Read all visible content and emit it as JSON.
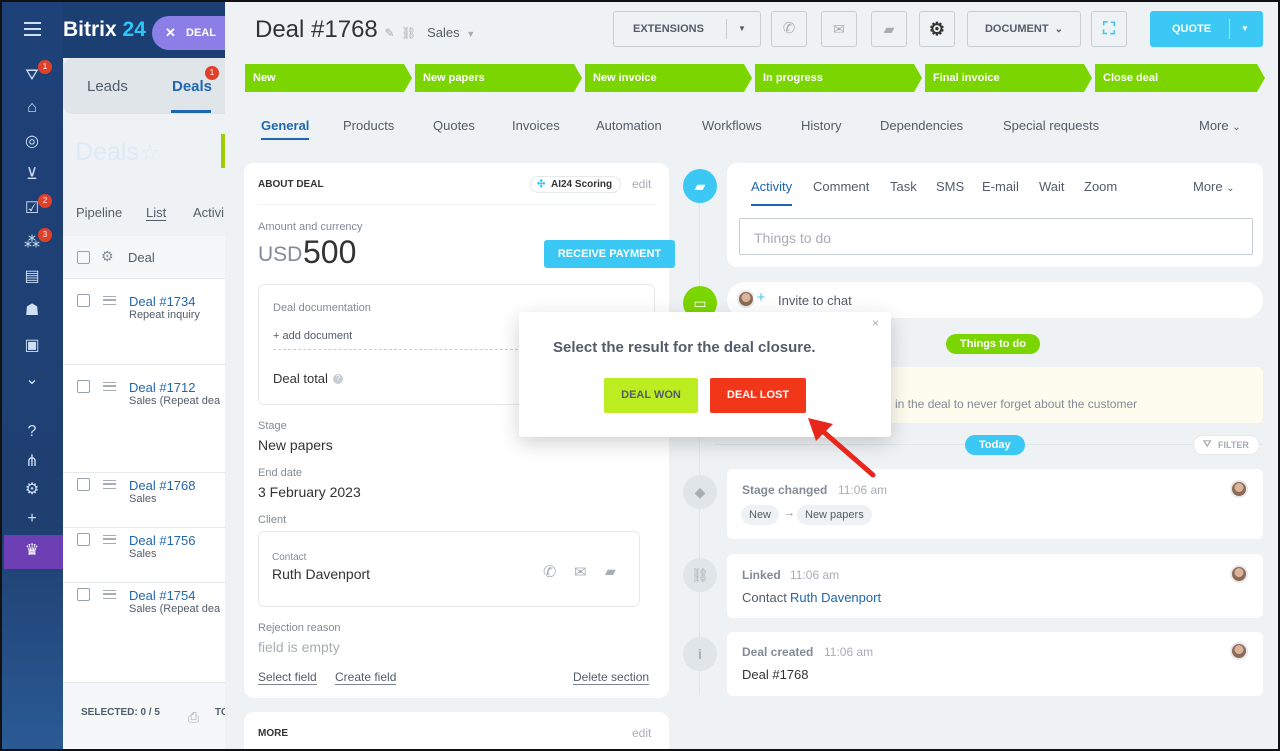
{
  "app": {
    "brand_name": "Bitrix",
    "brand_num": "24"
  },
  "left_toolbar": {
    "badges": [
      "1",
      "2",
      "3"
    ]
  },
  "background_crm": {
    "tab_leads": "Leads",
    "tab_deals": "Deals",
    "tab_deals_badge": "1",
    "deals_chip": "DEAL",
    "page_title": "Deals",
    "view_pipeline": "Pipeline",
    "view_list": "List",
    "view_activities": "Activi",
    "col_deal": "Deal",
    "rows": [
      {
        "title": "Deal #1734",
        "sub": "Repeat inquiry"
      },
      {
        "title": "Deal #1712",
        "sub": "Sales (Repeat dea"
      },
      {
        "title": "Deal #1768",
        "sub": "Sales"
      },
      {
        "title": "Deal #1756",
        "sub": "Sales"
      },
      {
        "title": "Deal #1754",
        "sub": "Sales (Repeat dea"
      }
    ],
    "selected": "SELECTED: 0 / 5",
    "to": "TO"
  },
  "header": {
    "title": "Deal #1768",
    "pipeline": "Sales",
    "extensions": "EXTENSIONS",
    "document": "DOCUMENT",
    "quote": "QUOTE"
  },
  "stages": [
    "New",
    "New papers",
    "New invoice",
    "In progress",
    "Final invoice",
    "Close deal"
  ],
  "stage_color": "#7bd500",
  "tabs": [
    "General",
    "Products",
    "Quotes",
    "Invoices",
    "Automation",
    "Workflows",
    "History",
    "Dependencies",
    "Special requests",
    "More"
  ],
  "about": {
    "heading": "ABOUT DEAL",
    "ai_scoring": "AI24 Scoring",
    "edit": "edit",
    "amount_label": "Amount and currency",
    "currency": "USD",
    "amount": "500",
    "receive_payment": "RECEIVE PAYMENT",
    "doc_label": "Deal documentation",
    "add_document": "+ add document",
    "deal_total": "Deal total",
    "stage_label": "Stage",
    "stage_value": "New papers",
    "end_date_label": "End date",
    "end_date_value": "3 February 2023",
    "client_label": "Client",
    "contact_label": "Contact",
    "contact_name": "Ruth Davenport",
    "rejection_label": "Rejection reason",
    "rejection_value": "field is empty",
    "select_field": "Select field",
    "create_field": "Create field",
    "delete_section": "Delete section"
  },
  "more": {
    "heading": "MORE",
    "edit": "edit"
  },
  "activity": {
    "tabs": [
      "Activity",
      "Comment",
      "Task",
      "SMS",
      "E-mail",
      "Wait",
      "Zoom",
      "More"
    ],
    "input_placeholder": "Things to do",
    "invite_chat": "Invite to chat",
    "things_to_do_badge": "Things to do",
    "hint": "in the deal to never forget about the customer",
    "today": "Today",
    "filter": "FILTER"
  },
  "timeline": [
    {
      "title": "Stage changed",
      "time": "11:06 am",
      "from": "New",
      "to": "New papers"
    },
    {
      "title": "Linked",
      "time": "11:06 am",
      "prefix": "Contact",
      "link": "Ruth Davenport"
    },
    {
      "title": "Deal created",
      "time": "11:06 am",
      "body": "Deal #1768"
    }
  ],
  "modal": {
    "question": "Select the result for the deal closure.",
    "won": "DEAL WON",
    "lost": "DEAL LOST",
    "won_color": "#bbed21",
    "lost_color": "#f1361a"
  }
}
